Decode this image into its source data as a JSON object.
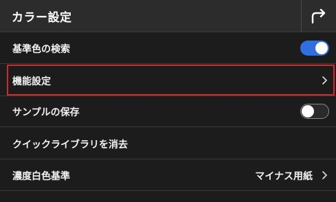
{
  "header": {
    "title": "カラー設定",
    "back_icon": "return-arrow-icon"
  },
  "rows": [
    {
      "label": "基準色の検索",
      "control": "toggle",
      "toggle_state": "on"
    },
    {
      "label": "機能設定",
      "control": "chevron",
      "highlighted": true
    },
    {
      "label": "サンプルの保存",
      "control": "toggle",
      "toggle_state": "off"
    },
    {
      "label": "クイックライブラリを消去",
      "control": "none"
    },
    {
      "label": "濃度白色基準",
      "value": "マイナス用紙",
      "control": "chevron"
    }
  ],
  "colors": {
    "header_bg": "#2c2c2c",
    "body_bg": "#1c1c1c",
    "toggle_on": "#2f6fe0",
    "highlight_border": "#d8262d"
  }
}
